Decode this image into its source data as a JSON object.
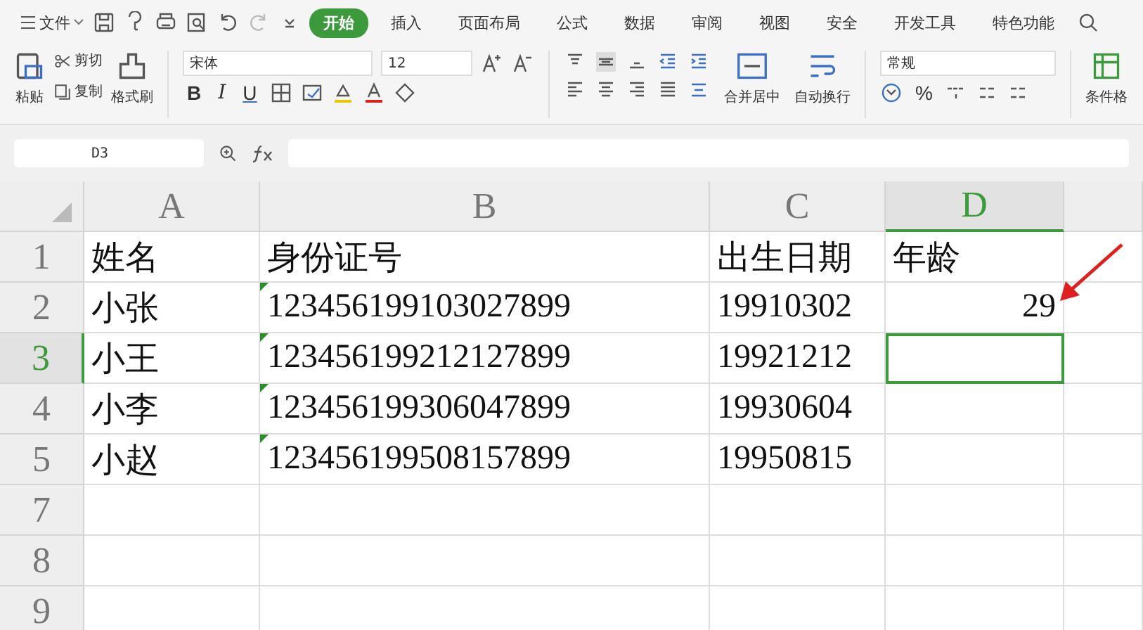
{
  "menu": {
    "file_label": "文件"
  },
  "tabs": [
    {
      "label": "开始",
      "selected": true
    },
    {
      "label": "插入",
      "selected": false
    },
    {
      "label": "页面布局",
      "selected": false
    },
    {
      "label": "公式",
      "selected": false
    },
    {
      "label": "数据",
      "selected": false
    },
    {
      "label": "审阅",
      "selected": false
    },
    {
      "label": "视图",
      "selected": false
    },
    {
      "label": "安全",
      "selected": false
    },
    {
      "label": "开发工具",
      "selected": false
    },
    {
      "label": "特色功能",
      "selected": false
    }
  ],
  "clipboard": {
    "paste": "粘贴",
    "cut": "剪切",
    "copy": "复制",
    "format_painter": "格式刷"
  },
  "font": {
    "name": "宋体",
    "size": "12",
    "bold": "B",
    "italic": "I",
    "underline": "U"
  },
  "alignment": {
    "merge_center": "合并居中",
    "wrap_text": "自动换行"
  },
  "number": {
    "format": "常规",
    "percent": "%"
  },
  "conditional_format": "条件格",
  "formula_bar": {
    "name_box": "D3"
  },
  "columns": [
    {
      "label": "A",
      "selected": false
    },
    {
      "label": "B",
      "selected": false
    },
    {
      "label": "C",
      "selected": false
    },
    {
      "label": "D",
      "selected": true
    },
    {
      "selected": false
    }
  ],
  "rows": [
    {
      "header": "1",
      "selected": false,
      "cells": [
        {
          "text": "姓名",
          "kind": "text",
          "selected": false
        },
        {
          "text": "身份证号",
          "kind": "text",
          "selected": false
        },
        {
          "text": "出生日期",
          "kind": "text",
          "selected": false
        },
        {
          "text": "年龄",
          "kind": "text",
          "selected": false
        }
      ]
    },
    {
      "header": "2",
      "selected": false,
      "cells": [
        {
          "text": "小张",
          "kind": "text",
          "selected": false
        },
        {
          "text": "123456199103027899",
          "kind": "text-number",
          "selected": false
        },
        {
          "text": "19910302",
          "kind": "text",
          "selected": false
        },
        {
          "text": "29",
          "kind": "number",
          "selected": false
        }
      ]
    },
    {
      "header": "3",
      "selected": true,
      "cells": [
        {
          "text": "小王",
          "kind": "text",
          "selected": false
        },
        {
          "text": "123456199212127899",
          "kind": "text-number",
          "selected": false
        },
        {
          "text": "19921212",
          "kind": "text",
          "selected": false
        },
        {
          "kind": "text",
          "selected": true
        }
      ]
    },
    {
      "header": "4",
      "selected": false,
      "cells": [
        {
          "text": "小李",
          "kind": "text",
          "selected": false
        },
        {
          "text": "123456199306047899",
          "kind": "text-number",
          "selected": false
        },
        {
          "text": "19930604",
          "kind": "text",
          "selected": false
        },
        {
          "kind": "text",
          "selected": false
        }
      ]
    },
    {
      "header": "5",
      "selected": false,
      "cells": [
        {
          "text": "小赵",
          "kind": "text",
          "selected": false
        },
        {
          "text": "123456199508157899",
          "kind": "text-number",
          "selected": false
        },
        {
          "text": "19950815",
          "kind": "text",
          "selected": false
        },
        {
          "kind": "text",
          "selected": false
        }
      ]
    },
    {
      "header": "7",
      "selected": false,
      "cells": []
    },
    {
      "header": "8",
      "selected": false,
      "cells": []
    },
    {
      "header": "9",
      "selected": false,
      "cells": []
    }
  ]
}
